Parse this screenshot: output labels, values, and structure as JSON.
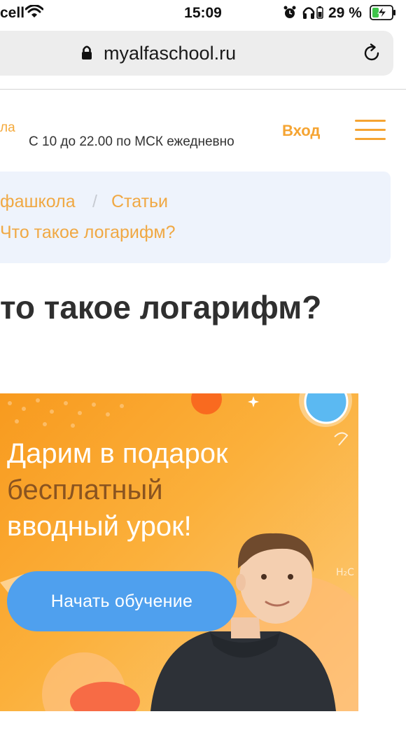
{
  "status_bar": {
    "carrier": "cell",
    "time": "15:09",
    "battery_percent": "29 %"
  },
  "browser": {
    "url": "myalfaschool.ru"
  },
  "header": {
    "logo_fragment": "ла",
    "work_hours": "С 10 до 22.00 по МСК ежедневно",
    "login_label": "Вход"
  },
  "breadcrumbs": {
    "home": "фашкола",
    "separator": "/",
    "articles": "Статьи",
    "current": "Что такое логарифм?"
  },
  "article": {
    "title": "то такое логарифм?"
  },
  "banner": {
    "line1": "Дарим в подарок",
    "line2": "бесплатный",
    "line3": "вводный урок!",
    "cta_label": "Начать обучение"
  },
  "colors": {
    "accent_orange": "#f5a432",
    "button_blue": "#4fa0ee",
    "breadcrumb_bg": "#eef3fc"
  }
}
